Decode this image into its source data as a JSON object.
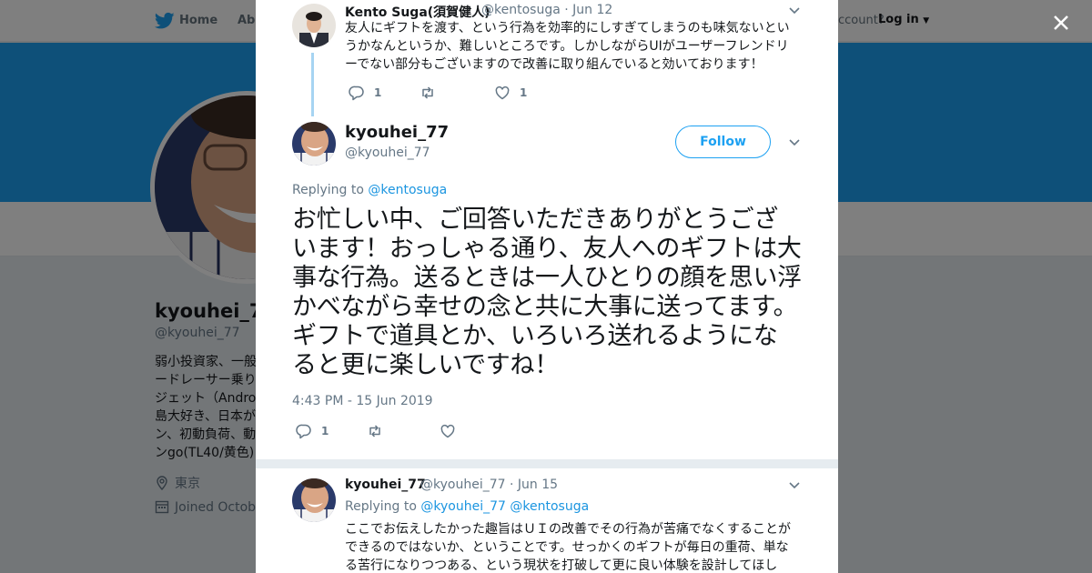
{
  "background": {
    "nav": {
      "home_label": "Home",
      "about_label": "Abo",
      "account_prompt": "ccount?",
      "login_label": "Log in"
    },
    "profile": {
      "name": "kyouhei_77",
      "handle": "@kyouhei_77",
      "bio": "弱小投資家、一般\nードレーサー乗り\nジェット（Androi\n島大好き、日本が\nン、初動負荷、動\nンgo(TL40/黄色)",
      "location": "東京",
      "joined": "Joined Octobe"
    },
    "banner_color": "#1da1f2"
  },
  "modal": {
    "parent_tweet": {
      "name": "Kento Suga(須賀健人)",
      "handle": "@kentosuga",
      "date": "· Jun 12",
      "text": "友人にギフトを渡す、という行為を効率的にしすぎてしまうのも味気ないというかなんというか、難しいところです。しかしながらUIがユーザーフレンドリーでない部分もございますので改善に取り組んでいると効いております！",
      "reply_count": "1",
      "retweet_count": "",
      "like_count": "1"
    },
    "main_tweet": {
      "name": "kyouhei_77",
      "handle": "@kyouhei_77",
      "follow_label": "Follow",
      "replying_prefix": "Replying to",
      "replying_to": "@kentosuga",
      "text": "お忙しい中、ご回答いただきありがとうございます！おっしゃる通り、友人へのギフトは大事な行為。送るときは一人ひとりの顔を思い浮かべながら幸せの念と共に大事に送ってます。ギフトで道具とか、いろいろ送れるようになると更に楽しいですね！",
      "timestamp": "4:43 PM - 15 Jun 2019",
      "reply_count": "1",
      "retweet_count": "",
      "like_count": ""
    },
    "reply_tweet": {
      "name": "kyouhei_77",
      "handle": "@kyouhei_77",
      "date": "· Jun 15",
      "replying_prefix": "Replying to",
      "replying_to_1": "@kyouhei_77",
      "replying_to_2": "@kentosuga",
      "text": "ここでお伝えしたかった趣旨はＵＩの改善でその行為が苦痛でなくすることができるのではないか、ということです。せっかくのギフトが毎日の重荷、単なる苦行になりつつある、という現状を打破して更に良い体験を設計してほし"
    }
  },
  "colors": {
    "accent": "#1da1f2",
    "link": "#1b95e0",
    "text": "#14171a",
    "muted": "#657786"
  },
  "icons": [
    "twitter-bird-icon",
    "close-icon",
    "reply-icon",
    "retweet-icon",
    "like-icon",
    "chevron-down-icon",
    "location-icon",
    "calendar-icon"
  ]
}
